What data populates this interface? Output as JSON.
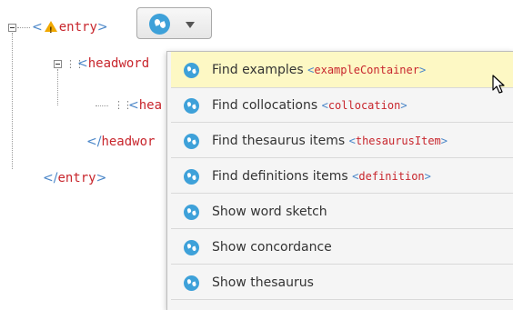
{
  "tree": {
    "entry_open": "entry",
    "headword_open": "headword",
    "child_open": "hea",
    "headword_close": "headwor",
    "entry_close": "entry",
    "lt": "<",
    "gt": ">",
    "close_lt": "</"
  },
  "menu": {
    "items": [
      {
        "label": "Find examples",
        "tag": "exampleContainer"
      },
      {
        "label": "Find collocations",
        "tag": "collocation"
      },
      {
        "label": "Find thesaurus items",
        "tag": "thesaurusItem"
      },
      {
        "label": "Find definitions items",
        "tag": "definition"
      },
      {
        "label": "Show word sketch",
        "tag": ""
      },
      {
        "label": "Show concordance",
        "tag": ""
      },
      {
        "label": "Show thesaurus",
        "tag": ""
      }
    ]
  },
  "colors": {
    "tag_name": "#c8262d",
    "bracket": "#4a86c8",
    "selected_bg": "#fdf8c4",
    "logo": "#3ea1d9"
  },
  "icons": [
    "collapse-icon",
    "warning-icon",
    "drag-handle-icon",
    "sketch-engine-logo-icon",
    "chevron-down-icon",
    "mouse-cursor-icon"
  ]
}
